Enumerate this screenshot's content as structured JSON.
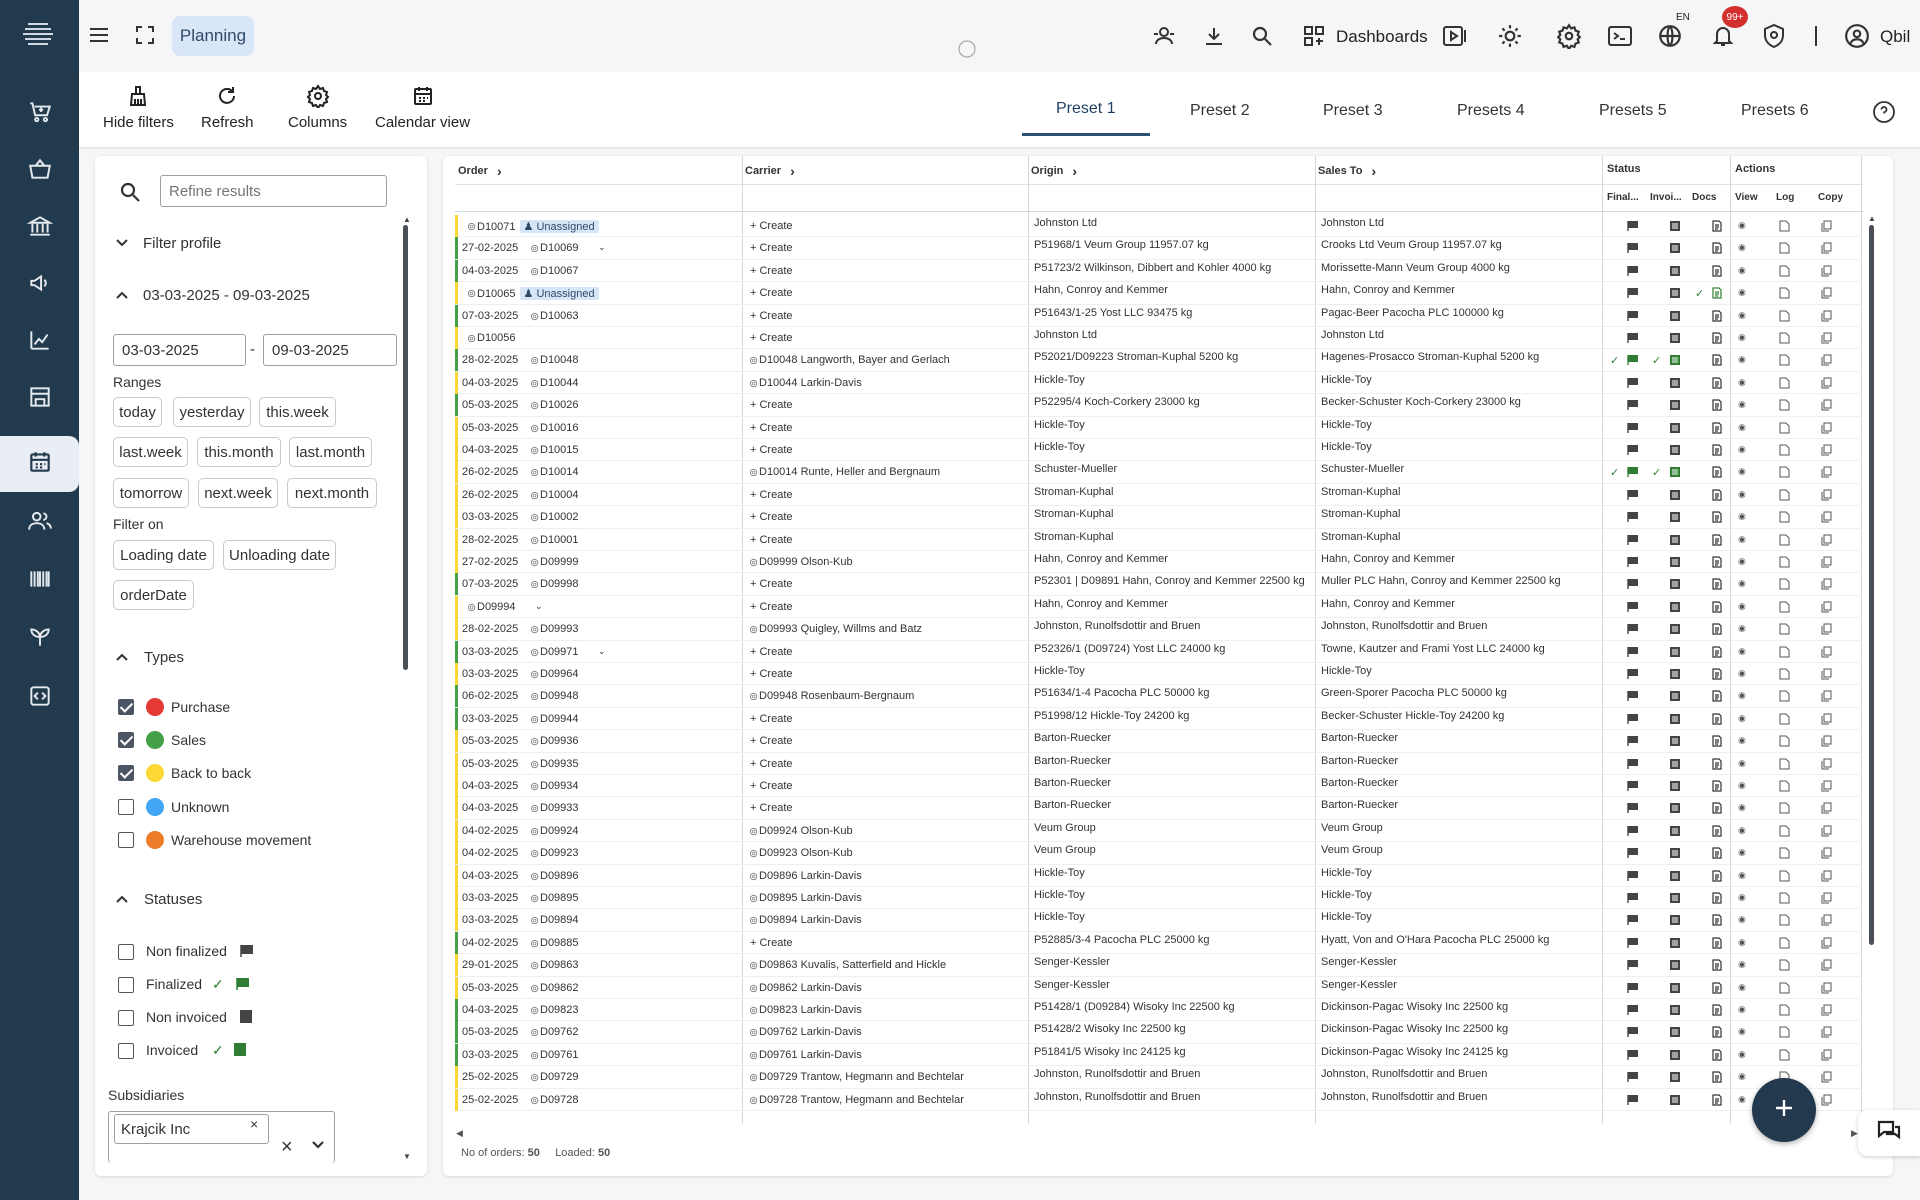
{
  "header": {
    "module": "Planning",
    "dashboards": "Dashboards",
    "lang": "EN",
    "notifications": "99+",
    "user": "Qbil"
  },
  "toolbar": {
    "hide_filters": "Hide filters",
    "refresh": "Refresh",
    "columns": "Columns",
    "calendar_view": "Calendar view"
  },
  "tabs": [
    "Preset 1",
    "Preset 2",
    "Preset 3",
    "Presets 4",
    "Presets 5",
    "Presets 6"
  ],
  "filters": {
    "search_placeholder": "Refine results",
    "filter_profile": "Filter profile",
    "date_range": "03-03-2025 - 09-03-2025",
    "date_from": "03-03-2025",
    "date_sep": "-",
    "date_to": "09-03-2025",
    "ranges_label": "Ranges",
    "ranges": [
      "today",
      "yesterday",
      "this.week",
      "last.week",
      "this.month",
      "last.month",
      "tomorrow",
      "next.week",
      "next.month"
    ],
    "filter_on_label": "Filter on",
    "filter_on": [
      "Loading date",
      "Unloading date",
      "orderDate"
    ],
    "types_label": "Types",
    "types": [
      {
        "label": "Purchase",
        "checked": true,
        "color": "#e53935"
      },
      {
        "label": "Sales",
        "checked": true,
        "color": "#43a047"
      },
      {
        "label": "Back to back",
        "checked": true,
        "color": "#fdd835"
      },
      {
        "label": "Unknown",
        "checked": false,
        "color": "#42a5f5"
      },
      {
        "label": "Warehouse movement",
        "checked": false,
        "color": "#ef7c2b"
      }
    ],
    "statuses_label": "Statuses",
    "statuses": [
      "Non finalized",
      "Finalized",
      "Non invoiced",
      "Invoiced"
    ],
    "subsidiaries_label": "Subsidiaries",
    "subsidiary": "Krajcik Inc"
  },
  "table": {
    "headers": {
      "order": "Order",
      "carrier": "Carrier",
      "origin": "Origin",
      "sales_to": "Sales To",
      "status": "Status",
      "actions": "Actions",
      "final": "Final...",
      "invoi": "Invoi...",
      "docs": "Docs",
      "view": "View",
      "log": "Log",
      "copy": "Copy"
    },
    "rows": [
      {
        "bar": "#fdd835",
        "date": "",
        "order": "D10071",
        "badge": "Unassigned",
        "carrier": "",
        "origin": "Johnston Ltd",
        "sales": "Johnston Ltd",
        "f": 0,
        "i": 0,
        "d": 0
      },
      {
        "bar": "#43a047",
        "date": "27-02-2025",
        "order": "D10069",
        "caret": true,
        "carrier": "",
        "origin": "P51968/1  Veum Group  11957.07 kg",
        "sales": "Crooks Ltd  Veum Group  11957.07 kg",
        "f": 0,
        "i": 0,
        "d": 0
      },
      {
        "bar": "#43a047",
        "date": "04-03-2025",
        "order": "D10067",
        "carrier": "",
        "origin": "P51723/2  Wilkinson, Dibbert and Kohler  4000 kg",
        "sales": "Morissette-Mann  Veum Group  4000 kg",
        "f": 0,
        "i": 0,
        "d": 0
      },
      {
        "bar": "#fdd835",
        "date": "",
        "order": "D10065",
        "badge": "Unassigned",
        "carrier": "",
        "origin": "Hahn, Conroy and Kemmer",
        "sales": "Hahn, Conroy and Kemmer",
        "f": 0,
        "i": 0,
        "d": 1
      },
      {
        "bar": "#43a047",
        "date": "07-03-2025",
        "order": "D10063",
        "carrier": "",
        "origin": "P51643/1-25  Yost LLC  93475 kg",
        "sales": "Pagac-Beer  Pacocha PLC  100000 kg",
        "f": 0,
        "i": 0,
        "d": 0
      },
      {
        "bar": "#fdd835",
        "date": "",
        "order": "D10056",
        "carrier": "",
        "origin": "Johnston Ltd",
        "sales": "Johnston Ltd",
        "f": 0,
        "i": 0,
        "d": 0
      },
      {
        "bar": "#43a047",
        "date": "28-02-2025",
        "order": "D10048",
        "carrier": "D10048  Langworth, Bayer and Gerlach",
        "origin": "P52021/D09223  Stroman-Kuphal  5200 kg",
        "sales": "Hagenes-Prosacco  Stroman-Kuphal  5200 kg",
        "f": 1,
        "i": 1,
        "d": 0
      },
      {
        "bar": "#fdd835",
        "date": "04-03-2025",
        "order": "D10044",
        "carrier": "D10044  Larkin-Davis",
        "origin": "Hickle-Toy",
        "sales": "Hickle-Toy",
        "f": 0,
        "i": 0,
        "d": 0
      },
      {
        "bar": "#43a047",
        "date": "05-03-2025",
        "order": "D10026",
        "carrier": "",
        "origin": "P52295/4  Koch-Corkery  23000 kg",
        "sales": "Becker-Schuster  Koch-Corkery  23000 kg",
        "f": 0,
        "i": 0,
        "d": 0
      },
      {
        "bar": "#fdd835",
        "date": "05-03-2025",
        "order": "D10016",
        "carrier": "",
        "origin": "Hickle-Toy",
        "sales": "Hickle-Toy",
        "f": 0,
        "i": 0,
        "d": 0
      },
      {
        "bar": "#fdd835",
        "date": "04-03-2025",
        "order": "D10015",
        "carrier": "",
        "origin": "Hickle-Toy",
        "sales": "Hickle-Toy",
        "f": 0,
        "i": 0,
        "d": 0
      },
      {
        "bar": "#fdd835",
        "date": "26-02-2025",
        "order": "D10014",
        "carrier": "D10014  Runte, Heller and Bergnaum",
        "origin": "Schuster-Mueller",
        "sales": "Schuster-Mueller",
        "f": 1,
        "i": 1,
        "d": 0
      },
      {
        "bar": "#fdd835",
        "date": "26-02-2025",
        "order": "D10004",
        "carrier": "",
        "origin": "Stroman-Kuphal",
        "sales": "Stroman-Kuphal",
        "f": 0,
        "i": 0,
        "d": 0
      },
      {
        "bar": "#fdd835",
        "date": "03-03-2025",
        "order": "D10002",
        "carrier": "",
        "origin": "Stroman-Kuphal",
        "sales": "Stroman-Kuphal",
        "f": 0,
        "i": 0,
        "d": 0
      },
      {
        "bar": "#fdd835",
        "date": "28-02-2025",
        "order": "D10001",
        "carrier": "",
        "origin": "Stroman-Kuphal",
        "sales": "Stroman-Kuphal",
        "f": 0,
        "i": 0,
        "d": 0
      },
      {
        "bar": "#fdd835",
        "date": "27-02-2025",
        "order": "D09999",
        "carrier": "D09999  Olson-Kub",
        "origin": "Hahn, Conroy and Kemmer",
        "sales": "Hahn, Conroy and Kemmer",
        "f": 0,
        "i": 0,
        "d": 0
      },
      {
        "bar": "#43a047",
        "date": "07-03-2025",
        "order": "D09998",
        "carrier": "",
        "origin": "P52301 | D09891  Hahn, Conroy and Kemmer  22500 kg",
        "sales": "Muller PLC  Hahn, Conroy and Kemmer  22500 kg",
        "f": 0,
        "i": 0,
        "d": 0
      },
      {
        "bar": "#fdd835",
        "date": "",
        "order": "D09994",
        "caret": true,
        "carrier": "",
        "origin": "Hahn, Conroy and Kemmer",
        "sales": "Hahn, Conroy and Kemmer",
        "f": 0,
        "i": 0,
        "d": 0
      },
      {
        "bar": "#fdd835",
        "date": "28-02-2025",
        "order": "D09993",
        "carrier": "D09993  Quigley, Willms and Batz",
        "origin": "Johnston, Runolfsdottir and Bruen",
        "sales": "Johnston, Runolfsdottir and Bruen",
        "f": 0,
        "i": 0,
        "d": 0
      },
      {
        "bar": "#43a047",
        "date": "03-03-2025",
        "order": "D09971",
        "caret": true,
        "carrier": "",
        "origin": "P52326/1 (D09724)  Yost LLC  24000 kg",
        "sales": "Towne, Kautzer and Frami  Yost LLC  24000 kg",
        "f": 0,
        "i": 0,
        "d": 0
      },
      {
        "bar": "#fdd835",
        "date": "03-03-2025",
        "order": "D09964",
        "carrier": "",
        "origin": "Hickle-Toy",
        "sales": "Hickle-Toy",
        "f": 0,
        "i": 0,
        "d": 0
      },
      {
        "bar": "#43a047",
        "date": "06-02-2025",
        "order": "D09948",
        "carrier": "D09948  Rosenbaum-Bergnaum",
        "origin": "P51634/1-4  Pacocha PLC  50000 kg",
        "sales": "Green-Sporer  Pacocha PLC  50000 kg",
        "f": 0,
        "i": 0,
        "d": 0
      },
      {
        "bar": "#43a047",
        "date": "03-03-2025",
        "order": "D09944",
        "carrier": "",
        "origin": "P51998/12  Hickle-Toy  24200 kg",
        "sales": "Becker-Schuster  Hickle-Toy  24200 kg",
        "f": 0,
        "i": 0,
        "d": 0
      },
      {
        "bar": "#fdd835",
        "date": "05-03-2025",
        "order": "D09936",
        "carrier": "",
        "origin": "Barton-Ruecker",
        "sales": "Barton-Ruecker",
        "f": 0,
        "i": 0,
        "d": 0
      },
      {
        "bar": "#fdd835",
        "date": "05-03-2025",
        "order": "D09935",
        "carrier": "",
        "origin": "Barton-Ruecker",
        "sales": "Barton-Ruecker",
        "f": 0,
        "i": 0,
        "d": 0
      },
      {
        "bar": "#fdd835",
        "date": "04-03-2025",
        "order": "D09934",
        "carrier": "",
        "origin": "Barton-Ruecker",
        "sales": "Barton-Ruecker",
        "f": 0,
        "i": 0,
        "d": 0
      },
      {
        "bar": "#fdd835",
        "date": "04-03-2025",
        "order": "D09933",
        "carrier": "",
        "origin": "Barton-Ruecker",
        "sales": "Barton-Ruecker",
        "f": 0,
        "i": 0,
        "d": 0
      },
      {
        "bar": "#fdd835",
        "date": "04-02-2025",
        "order": "D09924",
        "carrier": "D09924  Olson-Kub",
        "origin": "Veum Group",
        "sales": "Veum Group",
        "f": 0,
        "i": 0,
        "d": 0
      },
      {
        "bar": "#fdd835",
        "date": "04-02-2025",
        "order": "D09923",
        "carrier": "D09923  Olson-Kub",
        "origin": "Veum Group",
        "sales": "Veum Group",
        "f": 0,
        "i": 0,
        "d": 0
      },
      {
        "bar": "#fdd835",
        "date": "04-03-2025",
        "order": "D09896",
        "carrier": "D09896  Larkin-Davis",
        "origin": "Hickle-Toy",
        "sales": "Hickle-Toy",
        "f": 0,
        "i": 0,
        "d": 0
      },
      {
        "bar": "#fdd835",
        "date": "03-03-2025",
        "order": "D09895",
        "carrier": "D09895  Larkin-Davis",
        "origin": "Hickle-Toy",
        "sales": "Hickle-Toy",
        "f": 0,
        "i": 0,
        "d": 0
      },
      {
        "bar": "#fdd835",
        "date": "03-03-2025",
        "order": "D09894",
        "carrier": "D09894  Larkin-Davis",
        "origin": "Hickle-Toy",
        "sales": "Hickle-Toy",
        "f": 0,
        "i": 0,
        "d": 0
      },
      {
        "bar": "#43a047",
        "date": "04-02-2025",
        "order": "D09885",
        "carrier": "",
        "origin": "P52885/3-4  Pacocha PLC  25000 kg",
        "sales": "Hyatt, Von and O'Hara  Pacocha PLC  25000 kg",
        "f": 0,
        "i": 0,
        "d": 0
      },
      {
        "bar": "#fdd835",
        "date": "29-01-2025",
        "order": "D09863",
        "carrier": "D09863  Kuvalis, Satterfield and Hickle",
        "origin": "Senger-Kessler",
        "sales": "Senger-Kessler",
        "f": 0,
        "i": 0,
        "d": 0
      },
      {
        "bar": "#fdd835",
        "date": "05-03-2025",
        "order": "D09862",
        "carrier": "D09862  Larkin-Davis",
        "origin": "Senger-Kessler",
        "sales": "Senger-Kessler",
        "f": 0,
        "i": 0,
        "d": 0
      },
      {
        "bar": "#43a047",
        "date": "04-03-2025",
        "order": "D09823",
        "carrier": "D09823  Larkin-Davis",
        "origin": "P51428/1 (D09284)  Wisoky Inc  22500 kg",
        "sales": "Dickinson-Pagac  Wisoky Inc  22500 kg",
        "f": 0,
        "i": 0,
        "d": 0
      },
      {
        "bar": "#43a047",
        "date": "05-03-2025",
        "order": "D09762",
        "carrier": "D09762  Larkin-Davis",
        "origin": "P51428/2  Wisoky Inc  22500 kg",
        "sales": "Dickinson-Pagac  Wisoky Inc  22500 kg",
        "f": 0,
        "i": 0,
        "d": 0
      },
      {
        "bar": "#43a047",
        "date": "03-03-2025",
        "order": "D09761",
        "carrier": "D09761  Larkin-Davis",
        "origin": "P51841/5  Wisoky Inc  24125 kg",
        "sales": "Dickinson-Pagac  Wisoky Inc  24125 kg",
        "f": 0,
        "i": 0,
        "d": 0
      },
      {
        "bar": "#fdd835",
        "date": "25-02-2025",
        "order": "D09729",
        "carrier": "D09729  Trantow, Hegmann and Bechtelar",
        "origin": "Johnston, Runolfsdottir and Bruen",
        "sales": "Johnston, Runolfsdottir and Bruen",
        "f": 0,
        "i": 0,
        "d": 0
      },
      {
        "bar": "#fdd835",
        "date": "25-02-2025",
        "order": "D09728",
        "carrier": "D09728  Trantow, Hegmann and Bechtelar",
        "origin": "Johnston, Runolfsdottir and Bruen",
        "sales": "Johnston, Runolfsdottir and Bruen",
        "f": 0,
        "i": 0,
        "d": 0
      }
    ],
    "create_label": "+ Create",
    "footer_orders_label": "No of orders:",
    "footer_orders": "50",
    "footer_loaded_label": "Loaded:",
    "footer_loaded": "50"
  }
}
